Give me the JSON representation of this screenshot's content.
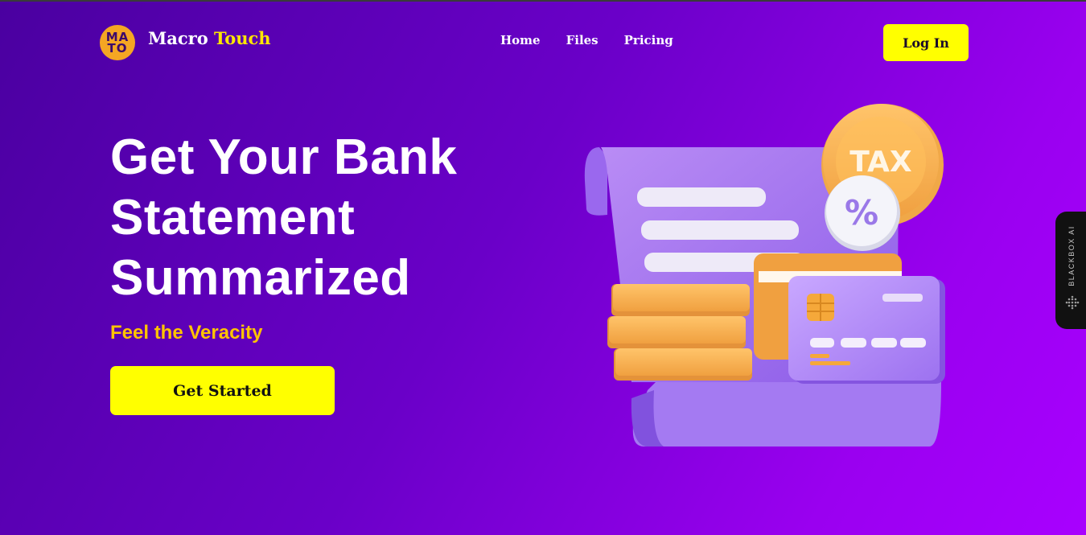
{
  "header": {
    "logo_badge_line1": "MA",
    "logo_badge_line2": "TO",
    "brand_word1": "Macro",
    "brand_word2": "Touch",
    "nav": [
      "Home",
      "Files",
      "Pricing"
    ],
    "login_label": "Log In"
  },
  "hero": {
    "headline": [
      "Get Your Bank",
      "Statement",
      "Summarized"
    ],
    "tagline": "Feel the Veracity",
    "cta_label": "Get Started"
  },
  "illustration": {
    "tax_label": "TAX",
    "percent_label": "%"
  },
  "side_widget": {
    "label": "BLACKBOX AI"
  },
  "colors": {
    "accent_yellow": "#ffff00",
    "brand_orange": "#f5a623",
    "tagline_gold": "#ffc400",
    "bg_start": "#4a00a0",
    "bg_end": "#a800ff"
  }
}
